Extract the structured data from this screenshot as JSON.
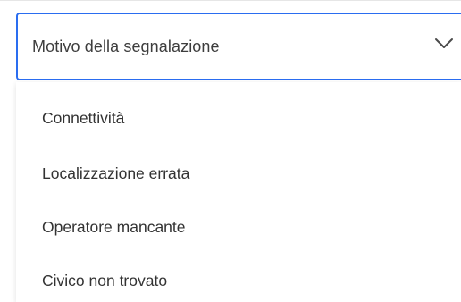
{
  "select": {
    "placeholder": "Motivo della segnalazione",
    "icon": "chevron-down-icon",
    "accent_color": "#2a6df0"
  },
  "options": [
    {
      "label": "Connettività"
    },
    {
      "label": "Localizzazione errata"
    },
    {
      "label": "Operatore mancante"
    },
    {
      "label": "Civico non trovato"
    }
  ]
}
